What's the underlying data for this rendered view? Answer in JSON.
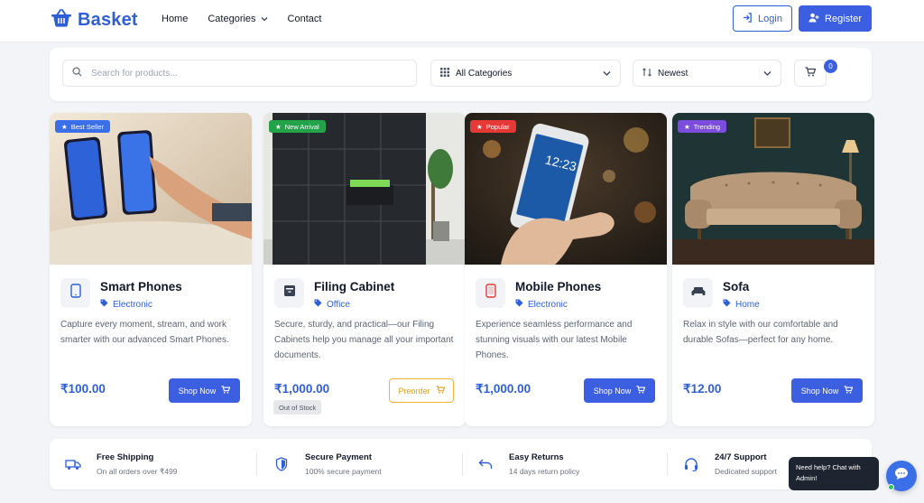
{
  "brand": {
    "name": "Basket",
    "color": "#2f5fd6"
  },
  "nav": [
    {
      "label": "Home"
    },
    {
      "label": "Categories"
    },
    {
      "label": "Contact"
    }
  ],
  "auth": {
    "login_label": "Login",
    "register_label": "Register"
  },
  "filters": {
    "search_placeholder": "Search for products...",
    "category_selected": "All Categories",
    "sort_selected": "Newest",
    "cart_count": "0"
  },
  "products": [
    {
      "badge": "Best Seller",
      "badge_color": "#3b6fe8",
      "title": "Smart Phones",
      "category": "Electronic",
      "description": "Capture every moment, stream, and work smarter with our advanced Smart Phones.",
      "price": "₹100.00",
      "action": "Shop Now",
      "icon": "smartphone-icon"
    },
    {
      "badge": "New Arrival",
      "badge_color": "#22a34a",
      "title": "Filing Cabinet",
      "category": "Office",
      "description": "Secure, sturdy, and practical—our Filing Cabinets help you manage all your important documents.",
      "price": "₹1,000.00",
      "action": "Preorder",
      "stock": "Out of Stock",
      "icon": "cabinet-icon"
    },
    {
      "badge": "Popular",
      "badge_color": "#e53935",
      "title": "Mobile Phones",
      "category": "Electronic",
      "description": "Experience seamless performance and stunning visuals with our latest Mobile Phones.",
      "price": "₹1,000.00",
      "action": "Shop Now",
      "icon": "mobile-icon"
    },
    {
      "badge": "Trending",
      "badge_color": "#7c4ddc",
      "title": "Sofa",
      "category": "Home",
      "description": "Relax in style with our comfortable and durable Sofas—perfect for any home.",
      "price": "₹12.00",
      "action": "Shop Now",
      "icon": "sofa-icon"
    }
  ],
  "features": [
    {
      "title": "Free Shipping",
      "subtitle": "On all orders over ₹499",
      "icon": "truck-icon"
    },
    {
      "title": "Secure Payment",
      "subtitle": "100% secure payment",
      "icon": "shield-icon"
    },
    {
      "title": "Easy Returns",
      "subtitle": "14 days return policy",
      "icon": "return-icon"
    },
    {
      "title": "24/7 Support",
      "subtitle": "Dedicated support",
      "icon": "headset-icon"
    }
  ],
  "chat": {
    "prompt": "Need help? Chat with Admin!"
  }
}
